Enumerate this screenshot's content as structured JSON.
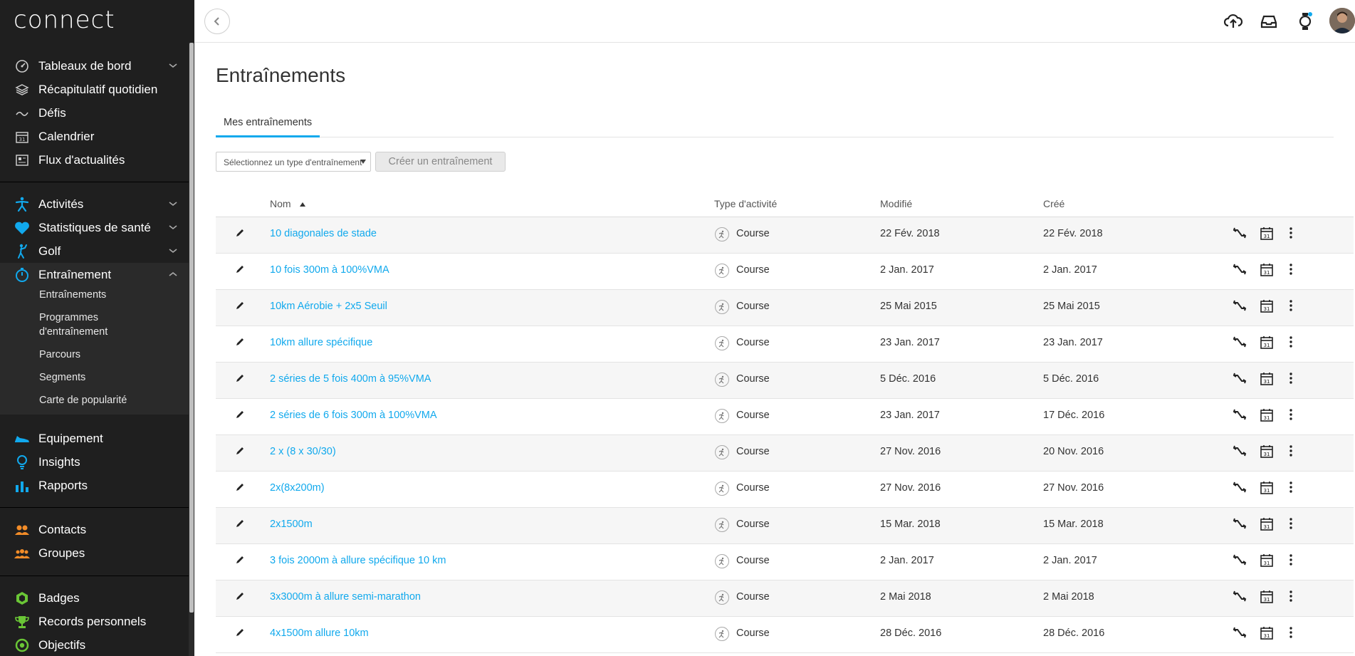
{
  "app": {
    "logo": "connect"
  },
  "sidebar": {
    "group1": [
      {
        "label": "Tableaux de bord",
        "icon": "dashboard-gauge-icon",
        "chevron": "down"
      },
      {
        "label": "Récapitulatif quotidien",
        "icon": "layers-icon",
        "chevron": ""
      },
      {
        "label": "Défis",
        "icon": "challenge-wave-icon",
        "chevron": ""
      },
      {
        "label": "Calendrier",
        "icon": "calendar-icon",
        "chevron": ""
      },
      {
        "label": "Flux d'actualités",
        "icon": "newsfeed-icon",
        "chevron": ""
      }
    ],
    "group2": [
      {
        "label": "Activités",
        "icon": "runner-icon",
        "chevron": "down"
      },
      {
        "label": "Statistiques de santé",
        "icon": "heart-icon",
        "chevron": "down"
      },
      {
        "label": "Golf",
        "icon": "golfer-icon",
        "chevron": "down"
      },
      {
        "label": "Entraînement",
        "icon": "stopwatch-icon",
        "chevron": "up"
      }
    ],
    "training_sub": [
      "Entraînements",
      "Programmes d'entraînement",
      "Parcours",
      "Segments",
      "Carte de popularité"
    ],
    "group3": [
      {
        "label": "Equipement",
        "icon": "shoe-icon"
      },
      {
        "label": "Insights",
        "icon": "lightbulb-icon"
      },
      {
        "label": "Rapports",
        "icon": "bar-chart-icon"
      }
    ],
    "group4": [
      {
        "label": "Contacts",
        "icon": "contacts-icon"
      },
      {
        "label": "Groupes",
        "icon": "groups-icon"
      }
    ],
    "group5": [
      {
        "label": "Badges",
        "icon": "badge-icon"
      },
      {
        "label": "Records personnels",
        "icon": "trophy-icon"
      },
      {
        "label": "Objectifs",
        "icon": "target-icon"
      }
    ]
  },
  "page": {
    "title": "Entraînements",
    "tab": "Mes entraînements",
    "select_placeholder": "Sélectionnez un type d'entraînement",
    "create_button": "Créer un entraînement"
  },
  "table": {
    "headers": {
      "name": "Nom",
      "type": "Type d'activité",
      "modified": "Modifié",
      "created": "Créé"
    },
    "rows": [
      {
        "name": "10 diagonales de stade",
        "type": "Course",
        "modified": "22 Fév. 2018",
        "created": "22 Fév. 2018"
      },
      {
        "name": "10 fois 300m à 100%VMA",
        "type": "Course",
        "modified": "2 Jan. 2017",
        "created": "2 Jan. 2017"
      },
      {
        "name": "10km Aérobie + 2x5 Seuil",
        "type": "Course",
        "modified": "25 Mai 2015",
        "created": "25 Mai 2015"
      },
      {
        "name": "10km allure spécifique",
        "type": "Course",
        "modified": "23 Jan. 2017",
        "created": "23 Jan. 2017"
      },
      {
        "name": "2 séries de 5 fois 400m à 95%VMA",
        "type": "Course",
        "modified": "5 Déc. 2016",
        "created": "5 Déc. 2016"
      },
      {
        "name": "2 séries de 6 fois 300m à 100%VMA",
        "type": "Course",
        "modified": "23 Jan. 2017",
        "created": "17 Déc. 2016"
      },
      {
        "name": "2 x (8 x 30/30)",
        "type": "Course",
        "modified": "27 Nov. 2016",
        "created": "20 Nov. 2016"
      },
      {
        "name": "2x(8x200m)",
        "type": "Course",
        "modified": "27 Nov. 2016",
        "created": "27 Nov. 2016"
      },
      {
        "name": "2x1500m",
        "type": "Course",
        "modified": "15 Mar. 2018",
        "created": "15 Mar. 2018"
      },
      {
        "name": "3 fois 2000m à allure spécifique 10 km",
        "type": "Course",
        "modified": "2 Jan. 2017",
        "created": "2 Jan. 2017"
      },
      {
        "name": "3x3000m à allure semi-marathon",
        "type": "Course",
        "modified": "2 Mai 2018",
        "created": "2 Mai 2018"
      },
      {
        "name": "4x1500m allure 10km",
        "type": "Course",
        "modified": "28 Déc. 2016",
        "created": "28 Déc. 2016"
      }
    ]
  },
  "colors": {
    "accent": "#11a9ed",
    "sidebar_bg": "#1f1f1f",
    "health": "#11a9ed",
    "social": "#f28c28",
    "achievements": "#6ac636"
  }
}
